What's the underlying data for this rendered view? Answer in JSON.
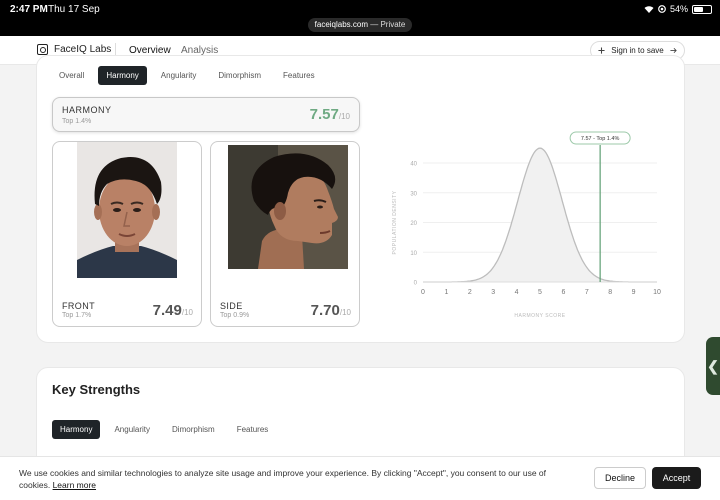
{
  "status": {
    "time": "2:47 PM",
    "date": "Thu 17 Sep",
    "url_domain": "faceiqlabs.com",
    "url_suffix": " — Private",
    "battery": "54%",
    "battery_level": 0.54
  },
  "nav": {
    "brand": "FaceIQ Labs",
    "tabs": [
      "Overview",
      "Analysis"
    ],
    "active_tab": "Overview",
    "signin": "Sign in to save"
  },
  "subtabs": [
    "Overall",
    "Harmony",
    "Angularity",
    "Dimorphism",
    "Features"
  ],
  "active_subtab": "Harmony",
  "harmony": {
    "label": "HARMONY",
    "sub": "Top 1.4%",
    "score": "7.57",
    "denom": "/10"
  },
  "front": {
    "label": "FRONT",
    "sub": "Top 1.7%",
    "score": "7.49",
    "denom": "/10"
  },
  "side": {
    "label": "SIDE",
    "sub": "Top 0.9%",
    "score": "7.70",
    "denom": "/10"
  },
  "chart_data": {
    "type": "area",
    "xlabel": "HARMONY SCORE",
    "ylabel": "POPULATION DENSITY",
    "xlim": [
      0,
      10
    ],
    "ylim": [
      0,
      45
    ],
    "x_ticks": [
      "0",
      "1",
      "2",
      "3",
      "4",
      "5",
      "6",
      "7",
      "8",
      "9",
      "10"
    ],
    "y_ticks": [
      "0",
      "10",
      "20",
      "30",
      "40"
    ],
    "distribution": {
      "mean": 5,
      "peak": 45
    },
    "marker": {
      "x": 7.57,
      "label": "7.57 - Top 1.4%"
    },
    "colors": {
      "curve": "#bdbdbd",
      "marker": "#5e9e73",
      "fill": "#f1f1f1"
    }
  },
  "strengths": {
    "title": "Key Strengths",
    "tabs": [
      "Harmony",
      "Angularity",
      "Dimorphism",
      "Features"
    ],
    "active": "Harmony"
  },
  "side_handle": "❮",
  "cookie": {
    "text": "We use cookies and similar technologies to analyze site usage and improve your experience. By clicking \"Accept\", you consent to our use of cookies.",
    "link": "Learn more",
    "decline": "Decline",
    "accept": "Accept"
  }
}
